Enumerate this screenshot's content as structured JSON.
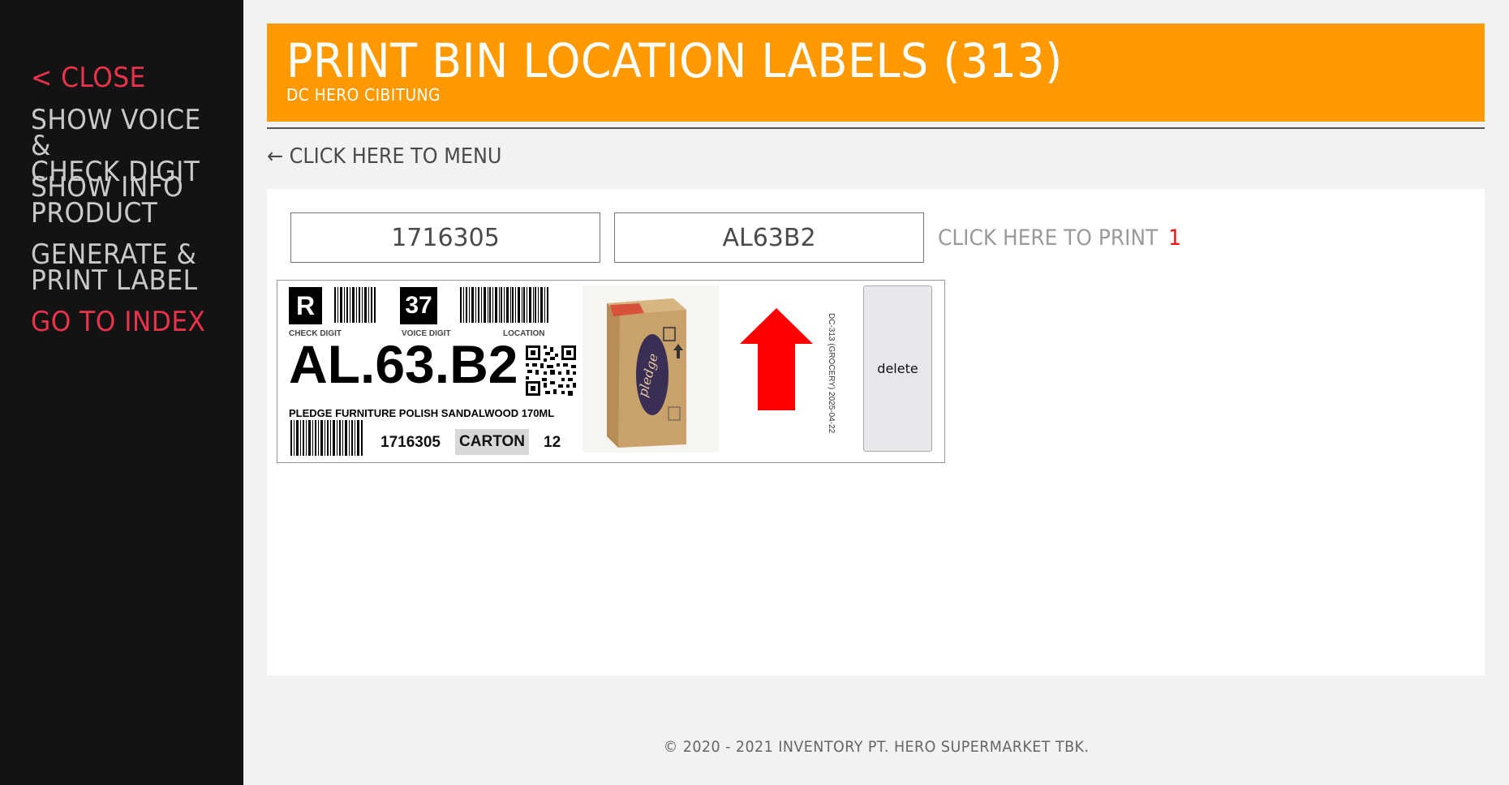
{
  "sidebar": {
    "close": "< CLOSE",
    "voice_line1": "SHOW VOICE &",
    "voice_line2": "CHECK DIGIT",
    "info_line1": "SHOW INFO",
    "info_line2": "PRODUCT",
    "generate_line1": "GENERATE &",
    "generate_line2": "PRINT LABEL",
    "index": "GO TO INDEX"
  },
  "header": {
    "title": "PRINT BIN LOCATION LABELS (313)",
    "subtitle": "DC HERO CIBITUNG"
  },
  "back_link": "← CLICK HERE TO MENU",
  "form": {
    "item_value": "1716305",
    "location_value": "AL63B2",
    "print_label": "CLICK HERE TO PRINT",
    "print_count": "1"
  },
  "label": {
    "check_digit": "R",
    "voice_digit": "37",
    "check_digit_caption": "CHECK DIGIT",
    "voice_digit_caption": "VOICE DIGIT",
    "location_caption": "LOCATION",
    "location": "AL.63.B2",
    "description": "PLEDGE FURNITURE POLISH SANDALWOOD 170ML",
    "item_code": "1716305",
    "uom": "CARTON",
    "qty": "12",
    "side_text": "DC-313 (GROCERY) 2025-04-22",
    "arrow_color": "#ff0000",
    "delete_label": "delete"
  },
  "footer": "© 2020 - 2021 INVENTORY PT. HERO SUPERMARKET TBK.",
  "colors": {
    "accent": "#ff9901",
    "sidebar_bg": "#131313",
    "nav_red": "#e8334a",
    "nav_gray": "#c9c9c9"
  }
}
